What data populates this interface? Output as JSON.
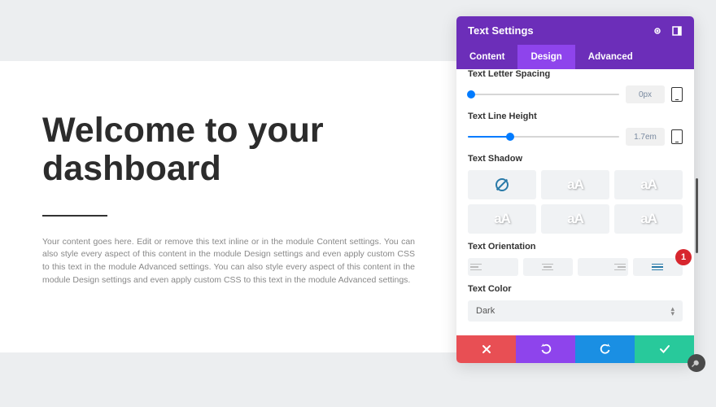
{
  "page": {
    "title": "Welcome to your dashboard",
    "body": "Your content goes here. Edit or remove this text inline or in the module Content settings. You can also style every aspect of this content in the module Design settings and even apply custom CSS to this text in the module Advanced settings. You can also style every aspect of this content in the module Design settings and even apply custom CSS to this text in the module Advanced settings."
  },
  "panel": {
    "title": "Text Settings",
    "tabs": {
      "content": "Content",
      "design": "Design",
      "advanced": "Advanced"
    },
    "letterSpacing": {
      "label": "Text Letter Spacing",
      "value": "0px",
      "percent": 2
    },
    "lineHeight": {
      "label": "Text Line Height",
      "value": "1.7em",
      "percent": 28
    },
    "shadow": {
      "label": "Text Shadow",
      "glyph": "aA"
    },
    "orientation": {
      "label": "Text Orientation",
      "callout": "1"
    },
    "textColor": {
      "label": "Text Color",
      "value": "Dark"
    }
  }
}
